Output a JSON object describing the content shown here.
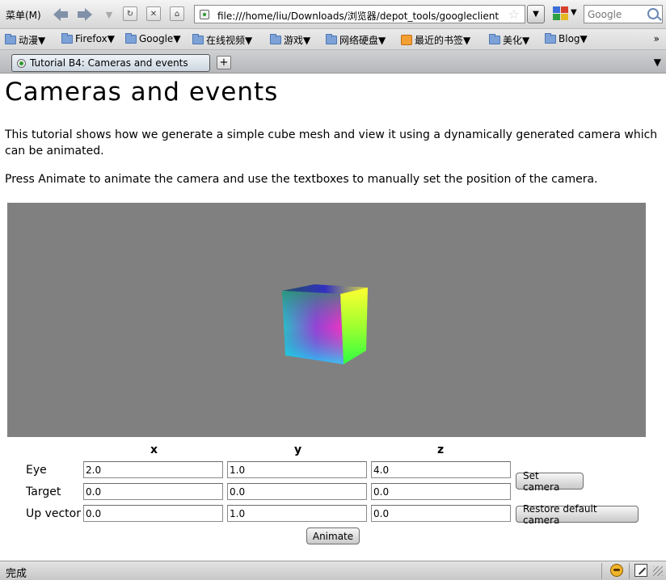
{
  "browser": {
    "menu_label": "菜单(M)",
    "url": "file:///home/liu/Downloads/浏览器/depot_tools/googleclient",
    "search_placeholder": "Google",
    "tab_title": "Tutorial B4: Cameras and events",
    "new_tab_label": "+",
    "status_text": "完成"
  },
  "bookmarks": [
    {
      "label": "动漫▼",
      "icon": "folder-icon"
    },
    {
      "label": "Firefox▼",
      "icon": "folder-icon"
    },
    {
      "label": "Google▼",
      "icon": "folder-icon"
    },
    {
      "label": "在线视频▼",
      "icon": "folder-icon"
    },
    {
      "label": "游戏▼",
      "icon": "folder-icon"
    },
    {
      "label": "网络硬盘▼",
      "icon": "folder-icon"
    },
    {
      "label": "最近的书签▼",
      "icon": "recent-bookmarks-icon"
    },
    {
      "label": "美化▼",
      "icon": "folder-icon"
    },
    {
      "label": "Blog▼",
      "icon": "folder-icon"
    }
  ],
  "page": {
    "title": "Cameras and events",
    "intro": "This tutorial shows how we generate a simple cube mesh and view it using a dynamically generated camera which can be animated.",
    "instructions": "Press Animate to animate the camera and use the textboxes to manually set the position of the camera.",
    "viewport_color": "#808080"
  },
  "camera_form": {
    "headers": [
      "x",
      "y",
      "z"
    ],
    "rows": [
      {
        "label": "Eye",
        "values": [
          "2.0",
          "1.0",
          "4.0"
        ]
      },
      {
        "label": "Target",
        "values": [
          "0.0",
          "0.0",
          "0.0"
        ]
      },
      {
        "label": "Up vector",
        "values": [
          "0.0",
          "1.0",
          "0.0"
        ]
      }
    ],
    "set_camera_label": "Set camera",
    "restore_label": "Restore default camera",
    "animate_label": "Animate"
  }
}
